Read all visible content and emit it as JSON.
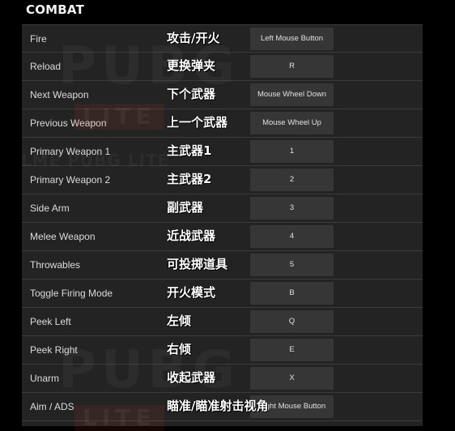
{
  "section": {
    "title": "COMBAT"
  },
  "rows": [
    {
      "action": "Fire",
      "annotation": "攻击/开火",
      "key": "Left Mouse Button"
    },
    {
      "action": "Reload",
      "annotation": "更换弹夹",
      "key": "R"
    },
    {
      "action": "Next Weapon",
      "annotation": "下个武器",
      "key": "Mouse Wheel Down"
    },
    {
      "action": "Previous Weapon",
      "annotation": "上一个武器",
      "key": "Mouse Wheel Up"
    },
    {
      "action": "Primary Weapon 1",
      "annotation": "主武器1",
      "key": "1"
    },
    {
      "action": "Primary Weapon 2",
      "annotation": "主武器2",
      "key": "2"
    },
    {
      "action": "Side Arm",
      "annotation": "副武器",
      "key": "3"
    },
    {
      "action": "Melee Weapon",
      "annotation": "近战武器",
      "key": "4"
    },
    {
      "action": "Throwables",
      "annotation": "可投掷道具",
      "key": "5"
    },
    {
      "action": "Toggle Firing Mode",
      "annotation": "开火模式",
      "key": "B"
    },
    {
      "action": "Peek Left",
      "annotation": "左倾",
      "key": "Q"
    },
    {
      "action": "Peek Right",
      "annotation": "右倾",
      "key": "E"
    },
    {
      "action": "Unarm",
      "annotation": "收起武器",
      "key": "X"
    },
    {
      "action": "Aim / ADS",
      "annotation": "瞄准/瞄准射击视角",
      "key": "Right Mouse Button"
    }
  ],
  "watermark": {
    "brand": "PUBG",
    "sub": "LITE",
    "small": "LME PUBG LITE"
  }
}
